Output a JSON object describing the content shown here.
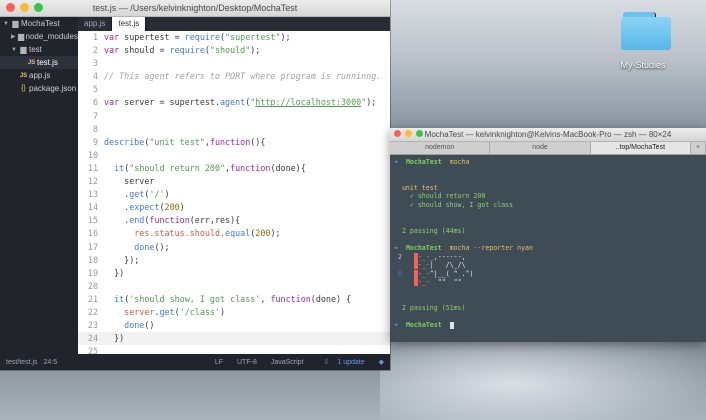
{
  "desktop": {
    "folder_label": "My-Studies"
  },
  "atom": {
    "title": "test.js — /Users/kelvinknighton/Desktop/MochaTest",
    "tree": [
      {
        "label": "MochaTest",
        "kind": "folder",
        "open": true
      },
      {
        "label": "node_modules",
        "kind": "folder",
        "open": false
      },
      {
        "label": "test",
        "kind": "folder",
        "open": true
      },
      {
        "label": "test.js",
        "kind": "js"
      },
      {
        "label": "app.js",
        "kind": "js"
      },
      {
        "label": "package.json",
        "kind": "json"
      }
    ],
    "tabs": [
      "app.js",
      "test.js"
    ],
    "status": {
      "path": "test/test.js",
      "cursor": "24:5",
      "eol": "LF",
      "encoding": "UTF-8",
      "grammar": "JavaScript",
      "update": "1 update"
    }
  },
  "terminal": {
    "title": "MochaTest — kelvinknighton@Kelvins-MacBook-Pro — zsh — 80×24",
    "tabs": [
      "nodemon",
      "node",
      "..top/MochaTest"
    ],
    "lines": {
      "dir": "MochaTest",
      "cmd1": "mocha",
      "suite": "unit test",
      "pass1": "✓ should return 200",
      "pass2": "✓ should show, I got class",
      "passing1": "2 passing (44ms)",
      "cmd2": "mocha --reporter nyan",
      "passing2": "2 passing (51ms)"
    }
  }
}
